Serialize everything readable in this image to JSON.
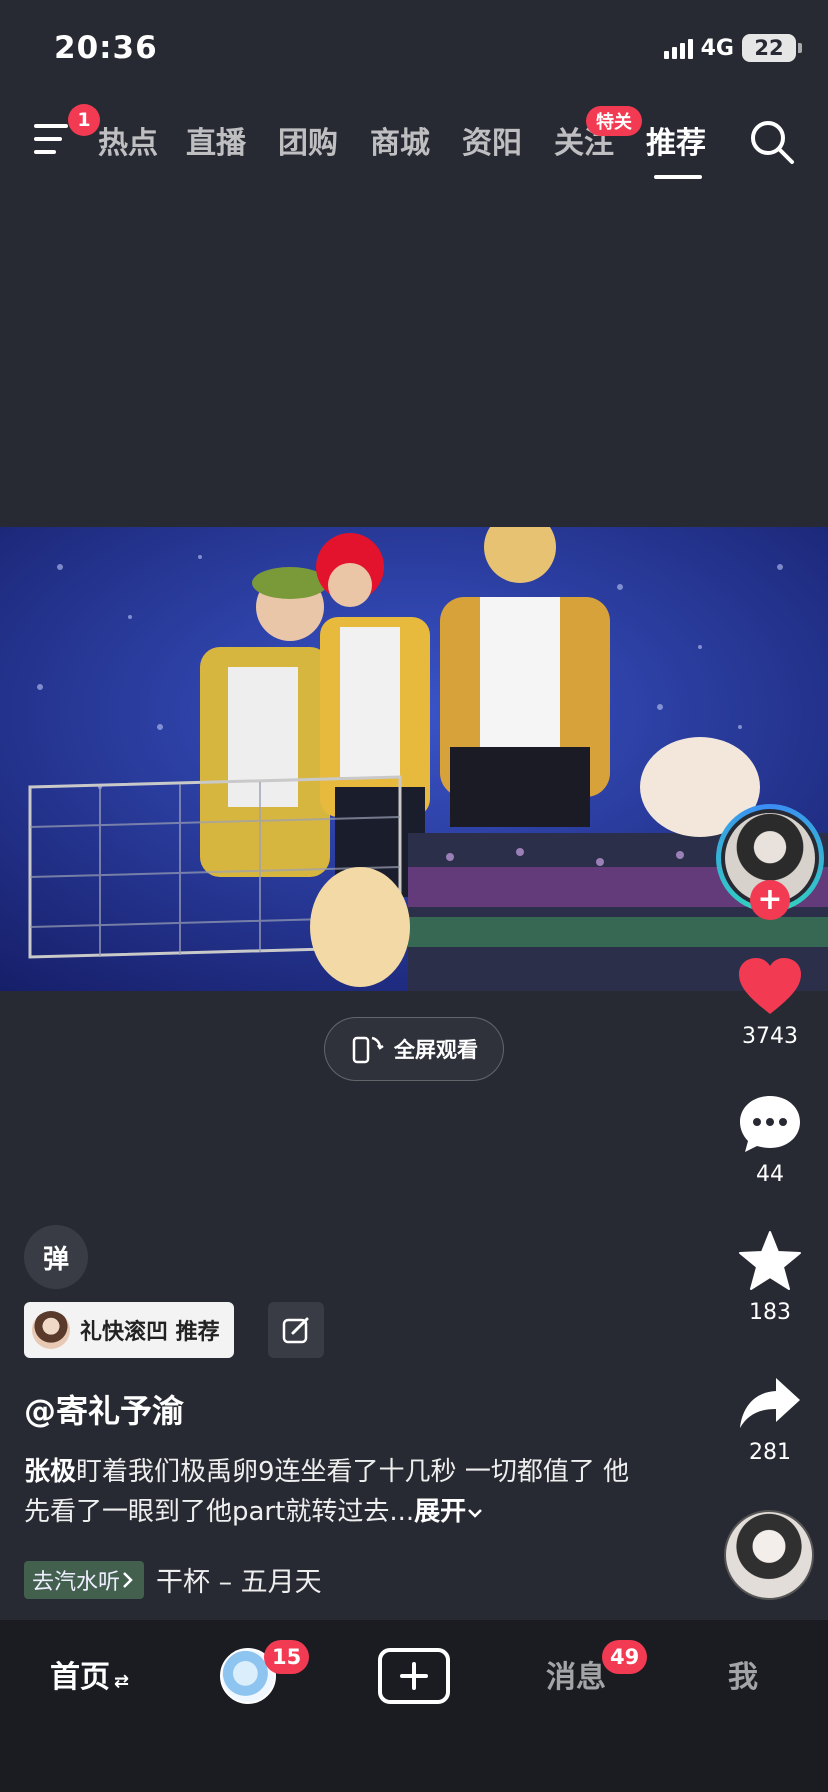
{
  "status": {
    "time": "20:36",
    "network": "4G",
    "battery": "22"
  },
  "top_nav": {
    "menu_badge": "1",
    "tabs": [
      "热点",
      "直播",
      "团购",
      "商城",
      "资阳",
      "关注",
      "推荐"
    ],
    "follow_badge": "特关"
  },
  "video": {
    "fullscreen_label": "全屏观看"
  },
  "actions": {
    "likes": "3743",
    "comments": "44",
    "favorites": "183",
    "shares": "281"
  },
  "info": {
    "danmu_label": "弹",
    "rec_chip": "礼快滚凹 推荐",
    "author": "@寄礼予渝",
    "desc_bold": "张极",
    "desc_text": "盯着我们极禹卵9连坐看了十几秒 一切都值了 他先看了一眼到了他part就转过去...",
    "expand_label": "展开",
    "music_tag": "去汽水听",
    "music_name": "干杯 – 五月天"
  },
  "bottom_tabs": {
    "home": "首页",
    "friends_badge": "15",
    "messages": "消息",
    "messages_badge": "49",
    "me": "我"
  }
}
